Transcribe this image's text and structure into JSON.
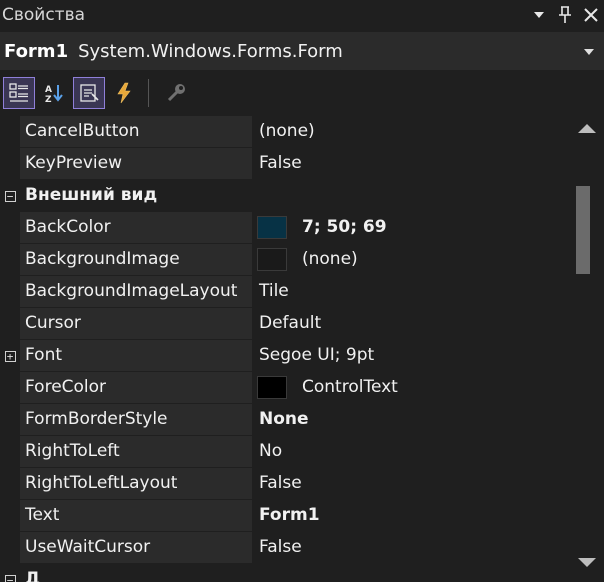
{
  "panel": {
    "title": "Свойства",
    "controls": {
      "pin_icon": "▾",
      "dock_icon": "📌",
      "close_icon": "✕"
    }
  },
  "object_selector": {
    "name": "Form1",
    "type": "System.Windows.Forms.Form"
  },
  "toolbar": {
    "buttons": [
      {
        "icon": "categorized-icon",
        "active": true
      },
      {
        "icon": "alphabetical-icon",
        "active": false
      },
      {
        "icon": "properties-icon",
        "active": true
      },
      {
        "icon": "events-icon",
        "active": false
      },
      {
        "icon": "property-pages-icon",
        "active": false
      }
    ]
  },
  "rows": [
    {
      "kind": "prop",
      "name": "CancelButton",
      "value": "(none)",
      "bold": false
    },
    {
      "kind": "prop",
      "name": "KeyPreview",
      "value": "False",
      "bold": false
    },
    {
      "kind": "category",
      "name": "Внешний вид",
      "expanded": true
    },
    {
      "kind": "prop",
      "name": "BackColor",
      "value": "7; 50; 69",
      "bold": true,
      "swatch": "#073245"
    },
    {
      "kind": "prop",
      "name": "BackgroundImage",
      "value": "(none)",
      "bold": false,
      "swatch": "#1a1a1a"
    },
    {
      "kind": "prop",
      "name": "BackgroundImageLayout",
      "value": "Tile",
      "bold": false
    },
    {
      "kind": "prop",
      "name": "Cursor",
      "value": "Default",
      "bold": false
    },
    {
      "kind": "prop",
      "name": "Font",
      "value": "Segoe UI; 9pt",
      "bold": false,
      "expandable": true
    },
    {
      "kind": "prop",
      "name": "ForeColor",
      "value": "ControlText",
      "bold": false,
      "swatch": "#000000"
    },
    {
      "kind": "prop",
      "name": "FormBorderStyle",
      "value": "None",
      "bold": true
    },
    {
      "kind": "prop",
      "name": "RightToLeft",
      "value": "No",
      "bold": false
    },
    {
      "kind": "prop",
      "name": "RightToLeftLayout",
      "value": "False",
      "bold": false
    },
    {
      "kind": "prop",
      "name": "Text",
      "value": "Form1",
      "bold": true
    },
    {
      "kind": "prop",
      "name": "UseWaitCursor",
      "value": "False",
      "bold": false
    },
    {
      "kind": "category",
      "name": "Д",
      "expanded": true
    }
  ]
}
